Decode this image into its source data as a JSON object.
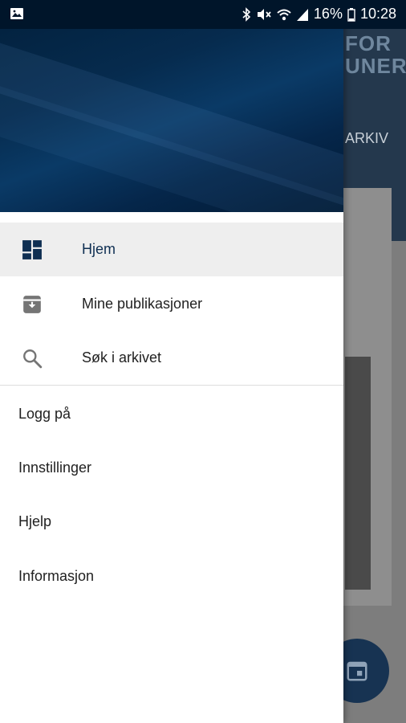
{
  "status_bar": {
    "battery": "16%",
    "time": "10:28",
    "icons": [
      "image-icon",
      "bluetooth-icon",
      "mute-icon",
      "wifi-icon",
      "signal-icon",
      "battery-icon"
    ]
  },
  "background_app": {
    "title_fragment": "FOR\nUNER",
    "tab_fragment": "ARKIV",
    "fab_icon": "calendar-icon"
  },
  "nav": {
    "items": [
      {
        "label": "Hjem",
        "icon": "dashboard-icon",
        "active": true
      },
      {
        "label": "Mine publikasjoner",
        "icon": "archive-download-icon",
        "active": false
      },
      {
        "label": "Søk i arkivet",
        "icon": "search-icon",
        "active": false
      }
    ]
  },
  "menu": {
    "items": [
      {
        "label": "Logg på"
      },
      {
        "label": "Innstillinger"
      },
      {
        "label": "Hjelp"
      },
      {
        "label": "Informasjon"
      }
    ]
  },
  "colors": {
    "status_bar": "#00152a",
    "drawer_header": "#062b4e",
    "active_item_bg": "#eeeeee",
    "active_label": "#0f2f52",
    "fab": "#173352"
  }
}
